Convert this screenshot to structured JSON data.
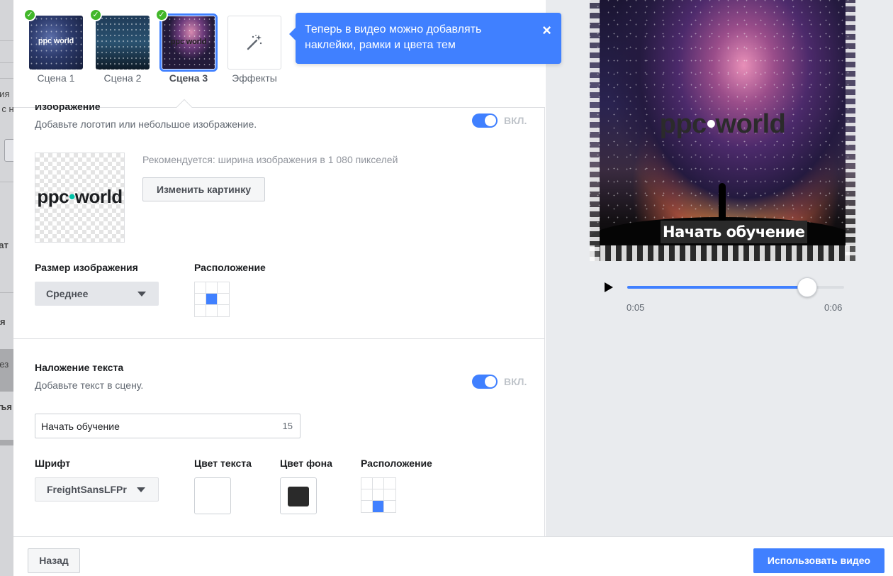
{
  "scenes": {
    "items": [
      {
        "label": "Сцена 1",
        "thumb_text": "ppc world",
        "completed": true,
        "selected": false
      },
      {
        "label": "Сцена 2",
        "thumb_text": "",
        "completed": true,
        "selected": false
      },
      {
        "label": "Сцена 3",
        "thumb_text": "ppc world",
        "completed": true,
        "selected": true
      }
    ],
    "effects_label": "Эффекты",
    "effects_icon": "magic-wand-icon"
  },
  "tooltip": {
    "text": "Теперь в видео можно добавлять наклейки, рамки и цвета тем",
    "close": "×"
  },
  "image_section": {
    "title": "Изображение",
    "subtitle": "Добавьте логотип или небольшое изображение.",
    "toggle_label": "ВКЛ.",
    "toggle_on": true,
    "logo_text_left": "ppc",
    "logo_text_dot": "•",
    "logo_text_right": "world",
    "hint": "Рекомендуется: ширина изображения в 1 080 пикселей",
    "change_button": "Изменить картинку",
    "size_label": "Размер изображения",
    "size_value": "Среднее",
    "position_label": "Расположение",
    "position_selected": "middle-center"
  },
  "text_section": {
    "title": "Наложение текста",
    "subtitle": "Добавьте текст в сцену.",
    "toggle_label": "ВКЛ.",
    "toggle_on": true,
    "input_value": "Начать обучение",
    "char_count": "15",
    "font_label": "Шрифт",
    "font_value": "FreightSansLFPr",
    "text_color_label": "Цвет текста",
    "text_color": "#ffffff",
    "bg_color_label": "Цвет фона",
    "bg_color": "#2a2a2a",
    "position_label": "Расположение",
    "position_selected": "bottom-center"
  },
  "preview": {
    "logo_left": "ppc",
    "logo_dot": "•",
    "logo_right": "world",
    "caption": "Начать обучение",
    "time_current": "0:05",
    "time_total": "0:06",
    "progress": 0.83
  },
  "footer": {
    "back_button": "Назад",
    "use_button": "Использовать видео"
  },
  "colors": {
    "accent": "#4080ff",
    "check": "#42b72a"
  }
}
